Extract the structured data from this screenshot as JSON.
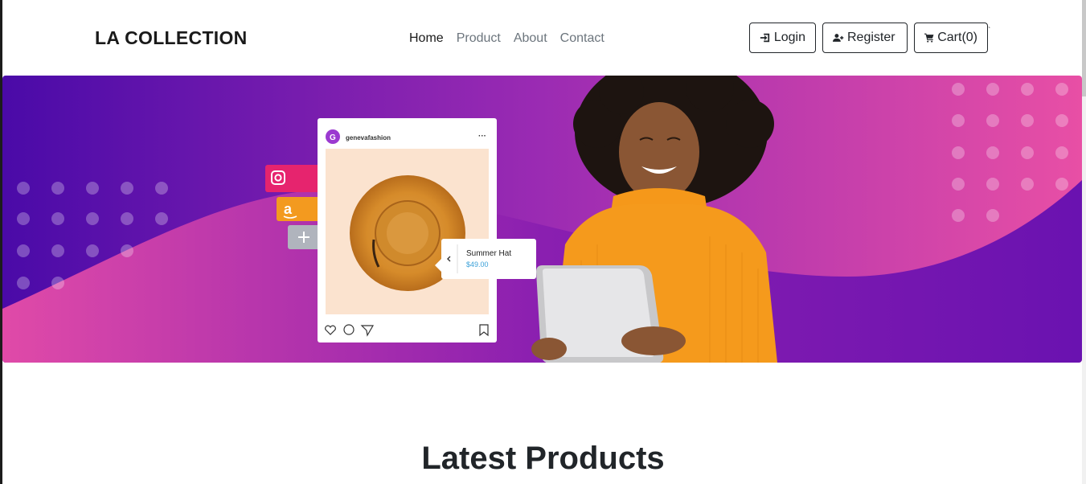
{
  "brand": "LA COLLECTION",
  "nav": {
    "links": [
      "Home",
      "Product",
      "About",
      "Contact"
    ],
    "active": "Home"
  },
  "buttons": {
    "login": "Login",
    "register": "Register",
    "cart": "Cart(0)"
  },
  "hero": {
    "post_username": "genevafashion",
    "post_avatar_letter": "G",
    "product_name": "Summer Hat",
    "product_price": "$49.00",
    "colors": {
      "gradient_start": "#4a0aa8",
      "gradient_mid": "#9b2bb3",
      "gradient_end": "#e84fa5",
      "sweater": "#f59a1c"
    }
  },
  "section": {
    "title": "Latest Products"
  }
}
